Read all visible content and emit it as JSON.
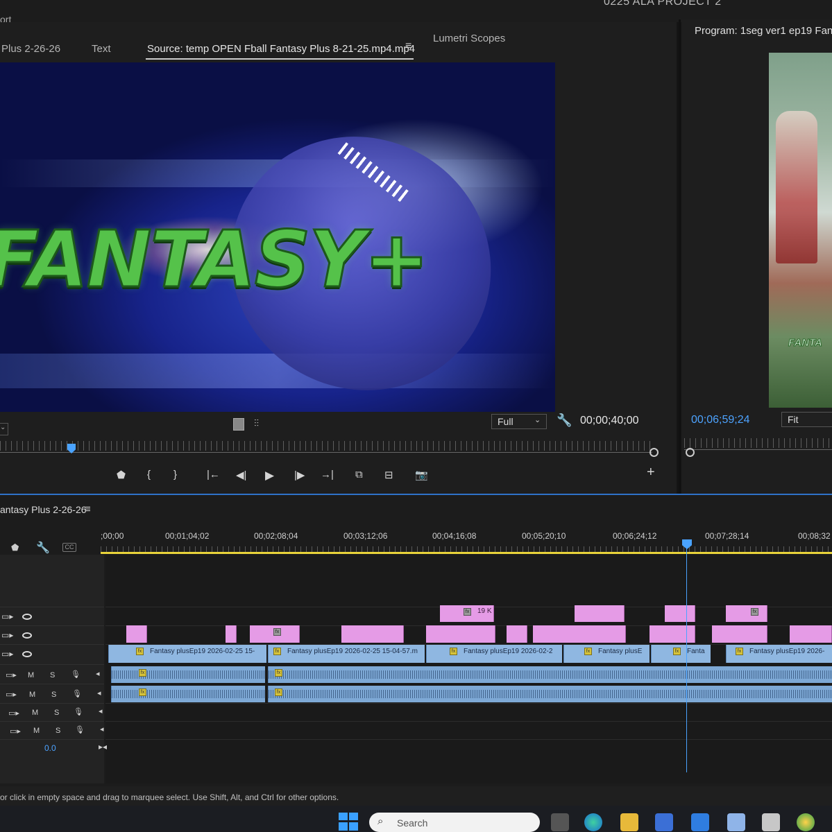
{
  "app": {
    "menu_fragment": "ort",
    "project_title": "0225 ALA PROJECT 2"
  },
  "source_panel": {
    "tabs": [
      {
        "label": "Plus 2-26-26"
      },
      {
        "label": "Text"
      },
      {
        "label": "Source: temp OPEN Fball Fantasy Plus 8-21-25.mp4.mp4",
        "active": true
      },
      {
        "label": "Lumetri Scopes"
      }
    ],
    "menu_icon": "≡",
    "video_logo": "FANTASY+",
    "zoom": "Full",
    "timecode": "00;00;40;00",
    "controls": {
      "marker": "⬟",
      "mark_in": "{",
      "mark_out": "}",
      "go_to_in": "|←",
      "step_back": "◀|",
      "play": "▶",
      "step_forward": "|▶",
      "go_to_out": "→|",
      "insert": "⧉",
      "overwrite": "⊟",
      "export_frame": "📷",
      "add": "+"
    }
  },
  "program_panel": {
    "title": "Program: 1seg ver1 ep19 Fant",
    "video_logo": "FANTA",
    "timecode": "00;06;59;24",
    "zoom": "Fit"
  },
  "timeline": {
    "sequence_name": "antasy Plus 2-26-26",
    "menu_icon": "≡",
    "ruler_labels": [
      ";00;00",
      "00;01;04;02",
      "00;02;08;04",
      "00;03;12;06",
      "00;04;16;08",
      "00;05;20;10",
      "00;06;24;12",
      "00;07;28;14",
      "00;08;32"
    ],
    "v_track_badge": "19 K",
    "v1_clips": [
      "Fantasy plusEp19 2026-02-25 15-",
      "Fantasy plusEp19 2026-02-25 15-04-57.m",
      "Fantasy plusEp19 2026-02-2",
      "Fantasy plusE",
      "Fanta",
      "Fantasy plusEp19 2026-"
    ],
    "audio_track_labels": {
      "mute": "M",
      "solo": "S"
    },
    "master_volume": "0.0"
  },
  "status_bar": {
    "text": "or click in empty space and drag to marquee select. Use Shift, Alt, and Ctrl for other options."
  },
  "taskbar": {
    "search_placeholder": "Search"
  },
  "colors": {
    "accent_blue": "#4aa3ff",
    "video_clip_pink": "#e59be6",
    "v1_clip_blue": "#8fb7e1",
    "work_area_yellow": "#e8d33a",
    "logo_green": "#55c24a"
  }
}
